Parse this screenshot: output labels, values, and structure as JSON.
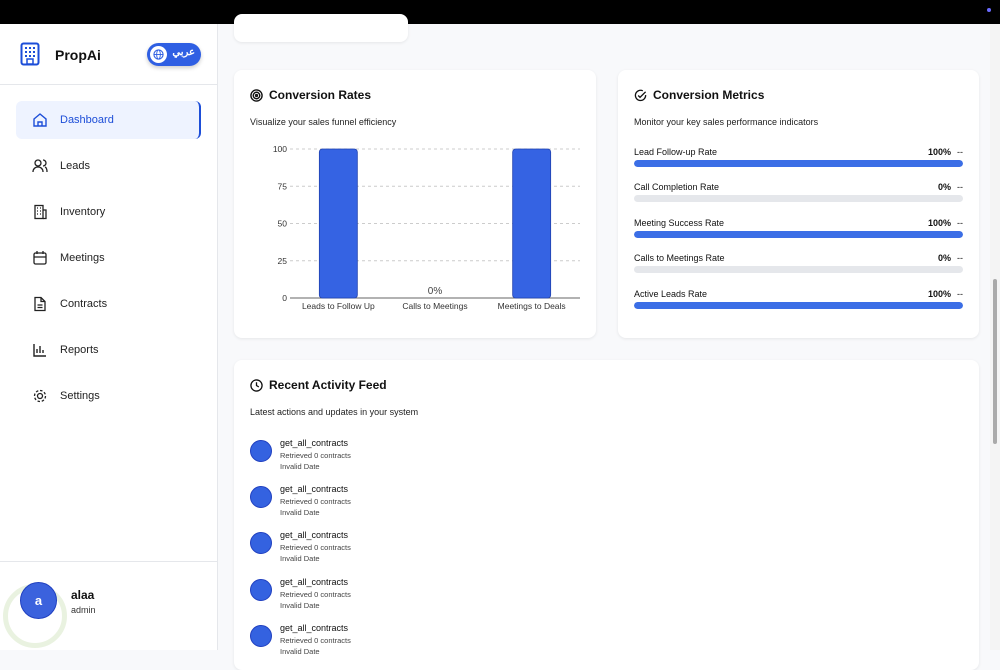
{
  "brand": {
    "name": "PropAi",
    "lang_toggle": "عربي"
  },
  "nav": [
    {
      "label": "Dashboard",
      "icon": "home-icon",
      "active": true
    },
    {
      "label": "Leads",
      "icon": "users-icon"
    },
    {
      "label": "Inventory",
      "icon": "building-icon"
    },
    {
      "label": "Meetings",
      "icon": "calendar-icon"
    },
    {
      "label": "Contracts",
      "icon": "file-icon"
    },
    {
      "label": "Reports",
      "icon": "bar-chart-icon"
    },
    {
      "label": "Settings",
      "icon": "gear-icon"
    }
  ],
  "user": {
    "initial": "a",
    "name": "alaa",
    "role": "admin"
  },
  "conversion_rates": {
    "title": "Conversion Rates",
    "subtitle": "Visualize your sales funnel efficiency"
  },
  "chart_data": {
    "type": "bar",
    "categories": [
      "Leads to Follow Up",
      "Calls to Meetings",
      "Meetings to Deals"
    ],
    "values": [
      100,
      0,
      100
    ],
    "zero_label": "0%",
    "ylim": [
      0,
      100
    ],
    "yticks": [
      0,
      25,
      50,
      75,
      100
    ],
    "grid": true,
    "color": "#3563e3"
  },
  "conversion_metrics": {
    "title": "Conversion Metrics",
    "subtitle": "Monitor your key sales performance indicators",
    "items": [
      {
        "label": "Lead Follow-up Rate",
        "value": "100%",
        "pct": 100,
        "trend": "--"
      },
      {
        "label": "Call Completion Rate",
        "value": "0%",
        "pct": 0,
        "trend": "--"
      },
      {
        "label": "Meeting Success Rate",
        "value": "100%",
        "pct": 100,
        "trend": "--"
      },
      {
        "label": "Calls to Meetings Rate",
        "value": "0%",
        "pct": 0,
        "trend": "--"
      },
      {
        "label": "Active Leads Rate",
        "value": "100%",
        "pct": 100,
        "trend": "--"
      }
    ]
  },
  "activity": {
    "title": "Recent Activity Feed",
    "subtitle": "Latest actions and updates in your system",
    "items": [
      {
        "name": "get_all_contracts",
        "desc": "Retrieved 0 contracts",
        "time": "Invalid Date"
      },
      {
        "name": "get_all_contracts",
        "desc": "Retrieved 0 contracts",
        "time": "Invalid Date"
      },
      {
        "name": "get_all_contracts",
        "desc": "Retrieved 0 contracts",
        "time": "Invalid Date"
      },
      {
        "name": "get_all_contracts",
        "desc": "Retrieved 0 contracts",
        "time": "Invalid Date"
      },
      {
        "name": "get_all_contracts",
        "desc": "Retrieved 0 contracts",
        "time": "Invalid Date"
      }
    ]
  }
}
